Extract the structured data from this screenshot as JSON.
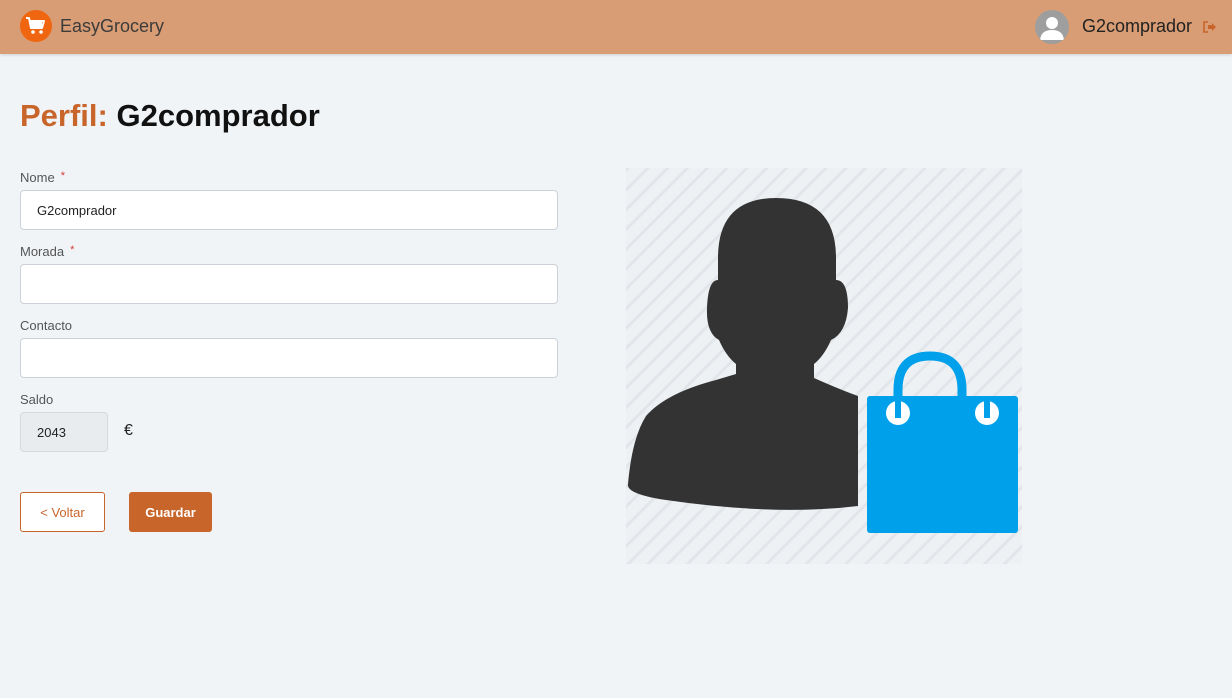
{
  "header": {
    "app_name": "EasyGrocery",
    "user_name": "G2comprador",
    "brand_color": "#d89d74",
    "logo_color": "#f0650f",
    "logo_icon": "shopping-cart-icon",
    "logout_icon": "sign-out-icon"
  },
  "page": {
    "title_prefix": "Perfil:",
    "title_name": "G2comprador",
    "accent_color": "#c8652a"
  },
  "form": {
    "nome": {
      "label": "Nome",
      "required_mark": "*",
      "value": "G2comprador"
    },
    "morada": {
      "label": "Morada",
      "required_mark": "*",
      "value": ""
    },
    "contacto": {
      "label": "Contacto",
      "value": ""
    },
    "saldo": {
      "label": "Saldo",
      "value": "2043",
      "currency": "€"
    }
  },
  "buttons": {
    "back_label": "< Voltar",
    "save_label": "Guardar"
  },
  "illustration": {
    "icon": "buyer-with-shopping-bag-icon",
    "silhouette_color": "#333333",
    "bag_color": "#00a0ea"
  }
}
